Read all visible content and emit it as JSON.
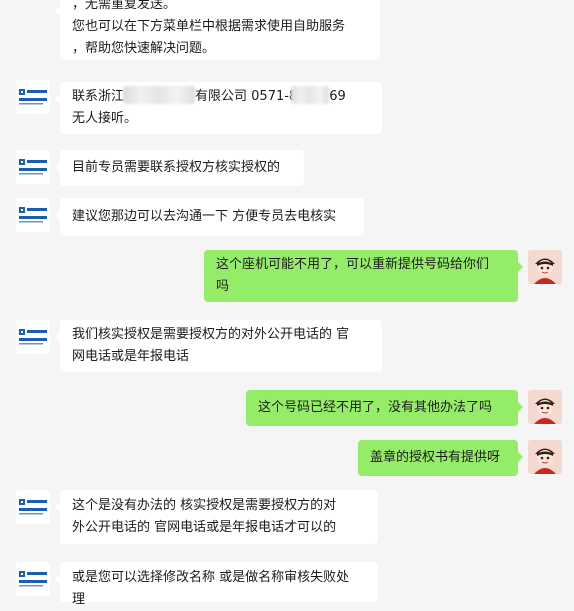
{
  "messages": [
    {
      "side": "left",
      "lines": [
        "，无需重复发送。",
        "您也可以在下方菜单栏中根据需求使用自助服务",
        "，帮助您快速解决问题。"
      ],
      "avatar": "company-logo-icon"
    },
    {
      "side": "left",
      "line1_a": "联系浙江中",
      "line1_b": "有限公司 0571-8",
      "line1_c": "69",
      "line2": " 无人接听。",
      "avatar": "company-logo-icon"
    },
    {
      "side": "left",
      "text": "目前专员需要联系授权方核实授权的",
      "avatar": "company-logo-icon"
    },
    {
      "side": "left",
      "text": "建议您那边可以去沟通一下 方便专员去电核实",
      "avatar": "company-logo-icon"
    },
    {
      "side": "right",
      "lines": [
        "这个座机可能不用了，可以重新提供号码给你们",
        "吗"
      ],
      "avatar": "user-cartoon-avatar"
    },
    {
      "side": "left",
      "lines": [
        "我们核实授权是需要授权方的对外公开电话的  官",
        "网电话或是年报电话"
      ],
      "avatar": "company-logo-icon"
    },
    {
      "side": "right",
      "text": "这个号码已经不用了，没有其他办法了吗",
      "avatar": "user-cartoon-avatar"
    },
    {
      "side": "right",
      "text": "盖章的授权书有提供呀",
      "avatar": "user-cartoon-avatar"
    },
    {
      "side": "left",
      "lines": [
        "这个是没有办法的     核实授权是需要授权方的对",
        "外公开电话的  官网电话或是年报电话才可以的"
      ],
      "avatar": "company-logo-icon"
    },
    {
      "side": "left",
      "lines": [
        "或是您可以选择修改名称 或是做名称审核失败处",
        "理"
      ],
      "avatar": "company-logo-icon"
    }
  ],
  "logo": {
    "top_text": "国家法大",
    "bottom_text": "KNZWABC",
    "accent": "#1a5fb4"
  },
  "colors": {
    "page_bg": "#f5f5f5",
    "left_bubble": "#ffffff",
    "right_bubble": "#95ec69",
    "text": "#1b1b1b"
  }
}
